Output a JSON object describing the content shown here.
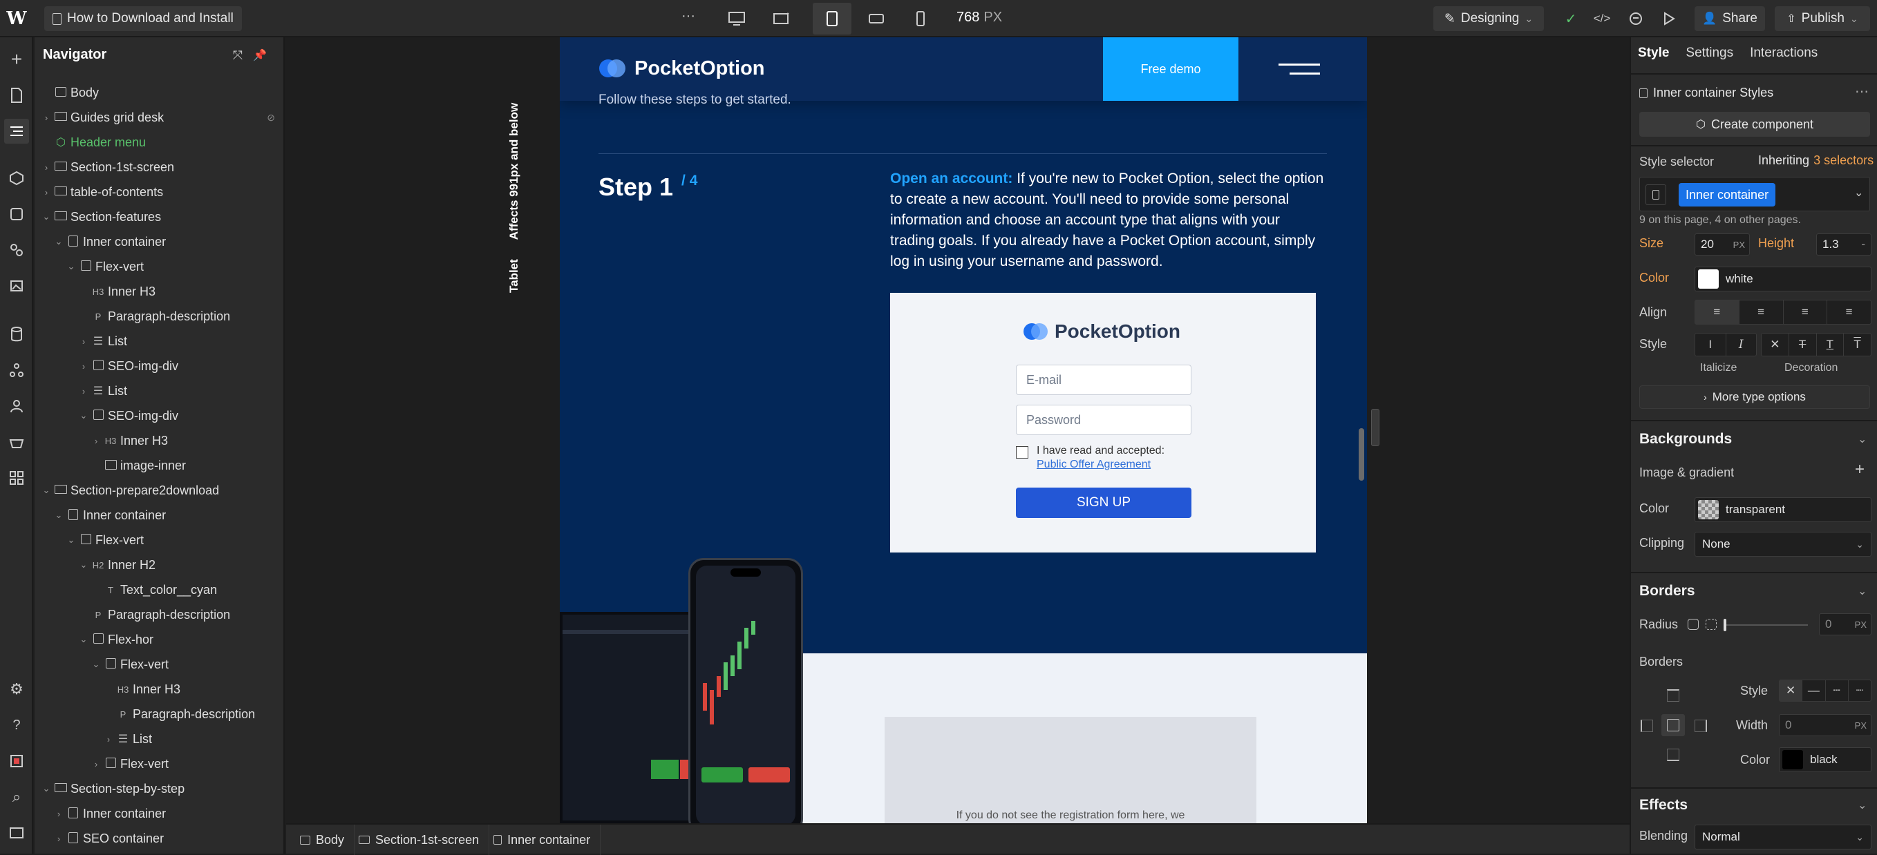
{
  "topbar": {
    "page_name": "How to Download and Install",
    "more": "···",
    "width_readout": "768",
    "width_unit": "PX",
    "mode_label": "Designing",
    "share_label": "Share",
    "publish_label": "Publish"
  },
  "navigator": {
    "title": "Navigator",
    "items": [
      {
        "label": "Body",
        "depth": 0,
        "caret": "",
        "icon": "page-icon"
      },
      {
        "label": "Guides grid desk",
        "depth": 0,
        "caret": "›",
        "icon": "section-icon",
        "hidden": true
      },
      {
        "label": "Header menu",
        "depth": 0,
        "caret": "",
        "icon": "component-icon",
        "component": true
      },
      {
        "label": "Section-1st-screen",
        "depth": 0,
        "caret": "›",
        "icon": "section-icon"
      },
      {
        "label": "table-of-contents",
        "depth": 0,
        "caret": "›",
        "icon": "section-icon"
      },
      {
        "label": "Section-features",
        "depth": 0,
        "caret": "⌄",
        "icon": "section-icon"
      },
      {
        "label": "Inner container",
        "depth": 1,
        "caret": "⌄",
        "icon": "container-icon"
      },
      {
        "label": "Flex-vert",
        "depth": 2,
        "caret": "⌄",
        "icon": "div-icon"
      },
      {
        "label": "Inner H3",
        "depth": 3,
        "caret": "",
        "icon": "H3"
      },
      {
        "label": "Paragraph-description",
        "depth": 3,
        "caret": "",
        "icon": "P"
      },
      {
        "label": "List",
        "depth": 3,
        "caret": "›",
        "icon": "list-icon"
      },
      {
        "label": "SEO-img-div",
        "depth": 3,
        "caret": "›",
        "icon": "div-icon"
      },
      {
        "label": "List",
        "depth": 3,
        "caret": "›",
        "icon": "list-icon"
      },
      {
        "label": "SEO-img-div",
        "depth": 3,
        "caret": "⌄",
        "icon": "div-icon"
      },
      {
        "label": "Inner H3",
        "depth": 4,
        "caret": "›",
        "icon": "H3"
      },
      {
        "label": "image-inner",
        "depth": 4,
        "caret": "",
        "icon": "image-icon"
      },
      {
        "label": "Section-prepare2download",
        "depth": 0,
        "caret": "⌄",
        "icon": "section-icon"
      },
      {
        "label": "Inner container",
        "depth": 1,
        "caret": "⌄",
        "icon": "container-icon"
      },
      {
        "label": "Flex-vert",
        "depth": 2,
        "caret": "⌄",
        "icon": "div-icon"
      },
      {
        "label": "Inner H2",
        "depth": 3,
        "caret": "⌄",
        "icon": "H2"
      },
      {
        "label": "Text_color__cyan",
        "depth": 4,
        "caret": "",
        "icon": "T"
      },
      {
        "label": "Paragraph-description",
        "depth": 3,
        "caret": "",
        "icon": "P"
      },
      {
        "label": "Flex-hor",
        "depth": 3,
        "caret": "⌄",
        "icon": "div-icon"
      },
      {
        "label": "Flex-vert",
        "depth": 4,
        "caret": "⌄",
        "icon": "div-icon"
      },
      {
        "label": "Inner H3",
        "depth": 5,
        "caret": "",
        "icon": "H3"
      },
      {
        "label": "Paragraph-description",
        "depth": 5,
        "caret": "",
        "icon": "P"
      },
      {
        "label": "List",
        "depth": 5,
        "caret": "›",
        "icon": "list-icon"
      },
      {
        "label": "Flex-vert",
        "depth": 4,
        "caret": "›",
        "icon": "div-icon"
      },
      {
        "label": "Section-step-by-step",
        "depth": 0,
        "caret": "⌄",
        "icon": "section-icon"
      },
      {
        "label": "Inner container",
        "depth": 1,
        "caret": "›",
        "icon": "container-icon"
      },
      {
        "label": "SEO container",
        "depth": 1,
        "caret": "›",
        "icon": "container-icon"
      }
    ]
  },
  "canvas": {
    "breakpoint_note": "Affects 991px and below",
    "breakpoint_name": "Tablet",
    "header": {
      "brand": "PocketOption",
      "demo_button": "Free demo"
    },
    "intro_text": "Follow these steps to get started.",
    "step": {
      "label": "Step",
      "number": "1",
      "total": "/ 4"
    },
    "body_lead": "Open an account:",
    "body_text": " If you're new to Pocket Option, select the option to create a new account. You'll need to provide some personal information and choose an account type that aligns with your trading goals. If you already have a Pocket Option account, simply log in using your username and password.",
    "form": {
      "brand": "PocketOption",
      "email_placeholder": "E-mail",
      "password_placeholder": "Password",
      "accept_text": "I have read and accepted:",
      "accept_link": "Public Offer Agreement",
      "signup": "SIGN UP"
    },
    "note_text": "If you do not see the registration form here, we"
  },
  "breadcrumb": [
    "Body",
    "Section-1st-screen",
    "Inner container"
  ],
  "right": {
    "tabs": [
      "Style",
      "Settings",
      "Interactions"
    ],
    "styles_title": "Inner container Styles",
    "create_component": "Create component",
    "style_selector_label": "Style selector",
    "inheriting_label": "Inheriting",
    "inheriting_count": "3 selectors",
    "selector_chip": "Inner container",
    "usage_note": "9 on this page, 4 on other pages.",
    "size_label": "Size",
    "size_value": "20",
    "size_unit": "PX",
    "height_label": "Height",
    "height_value": "1.3",
    "height_unit": "-",
    "color_label": "Color",
    "color_value": "white",
    "align_label": "Align",
    "style_label": "Style",
    "italicize_label": "Italicize",
    "decoration_label": "Decoration",
    "more_type": "More type options",
    "backgrounds_title": "Backgrounds",
    "image_gradient": "Image & gradient",
    "bg_color_label": "Color",
    "bg_color_value": "transparent",
    "clipping_label": "Clipping",
    "clipping_value": "None",
    "borders_title": "Borders",
    "radius_label": "Radius",
    "radius_value": "0",
    "radius_unit": "PX",
    "borders_label": "Borders",
    "border_style_label": "Style",
    "border_width_label": "Width",
    "border_width_value": "0",
    "border_width_unit": "PX",
    "border_color_label": "Color",
    "border_color_value": "black",
    "effects_title": "Effects",
    "blending_label": "Blending",
    "blending_value": "Normal"
  },
  "colors": {
    "accent": "#1a73e8",
    "site_bg": "#032758",
    "demo_button": "#0ea5ff",
    "signup": "#2357d6",
    "orange": "#f0a050",
    "component_green": "#59c26b"
  }
}
